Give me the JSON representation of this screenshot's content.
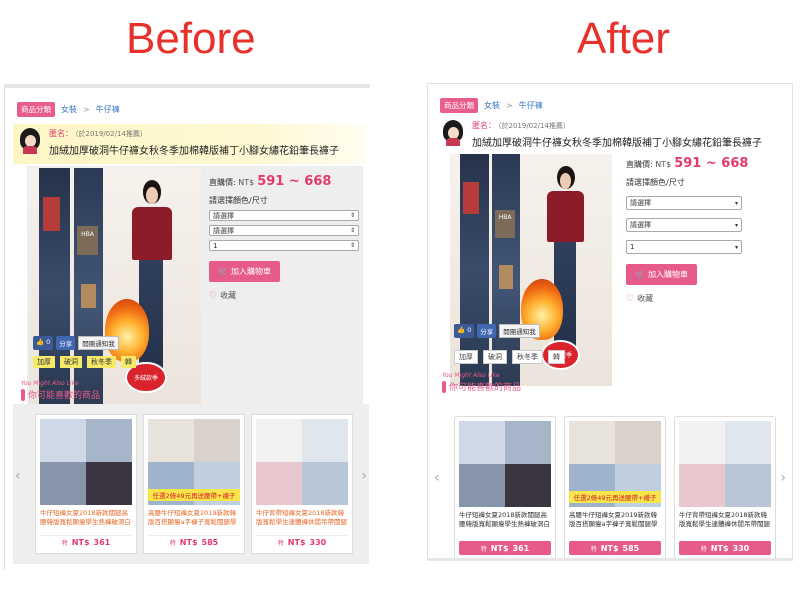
{
  "headings": {
    "before": "Before",
    "after": "After"
  },
  "breadcrumb": {
    "category_badge": "商品分類",
    "level1": "女裝",
    "separator": ">",
    "level2": "牛仔褲"
  },
  "seller": {
    "name": "匿名：",
    "date": "（於2019/02/14推薦）"
  },
  "product": {
    "title": "加絨加厚破洞牛仔褲女秋冬季加棉韓版補丁小腳女繡花鉛筆長褲子",
    "price_label": "直購價:",
    "currency": "NT$",
    "price_range": "591 ~ 668",
    "spec_label": "請選擇顏色/尺寸",
    "selects": [
      "請選擇",
      "請選擇",
      "1"
    ],
    "cart_button": "加入購物車",
    "favorite": "收藏",
    "image_patch_text": "HBA",
    "image_stamp_text": "多絨款季"
  },
  "social": {
    "like": "👍 0",
    "share": "分享",
    "notify": "開團通知我"
  },
  "tags": [
    "加厚",
    "破洞",
    "秋冬季",
    "韓"
  ],
  "recommend": {
    "subtitle": "You Might Also Like",
    "title": "你可能喜歡的商品"
  },
  "cards": [
    {
      "name": "牛仔短褲女夏2018新款闊腿高腰韓版寬鬆顯瘦學生熱褲破洞白",
      "price_prefix": "NT$",
      "price": "361",
      "promo": ""
    },
    {
      "name": "高腰牛仔短褲女夏2019新款韓版百搭顯瘦a字褲子寬鬆闊腿學",
      "price_prefix": "NT$",
      "price": "585",
      "promo": "任選2條49元再送腰帶+襪子"
    },
    {
      "name": "牛仔背帶短褲女夏2018新款韓版寬鬆學生連體褲休閒吊帶闊腿",
      "price_prefix": "NT$",
      "price": "330",
      "promo": ""
    }
  ],
  "colors": {
    "accent": "#e75b8a",
    "heading": "#e8312a",
    "price": "#e23b6b"
  }
}
